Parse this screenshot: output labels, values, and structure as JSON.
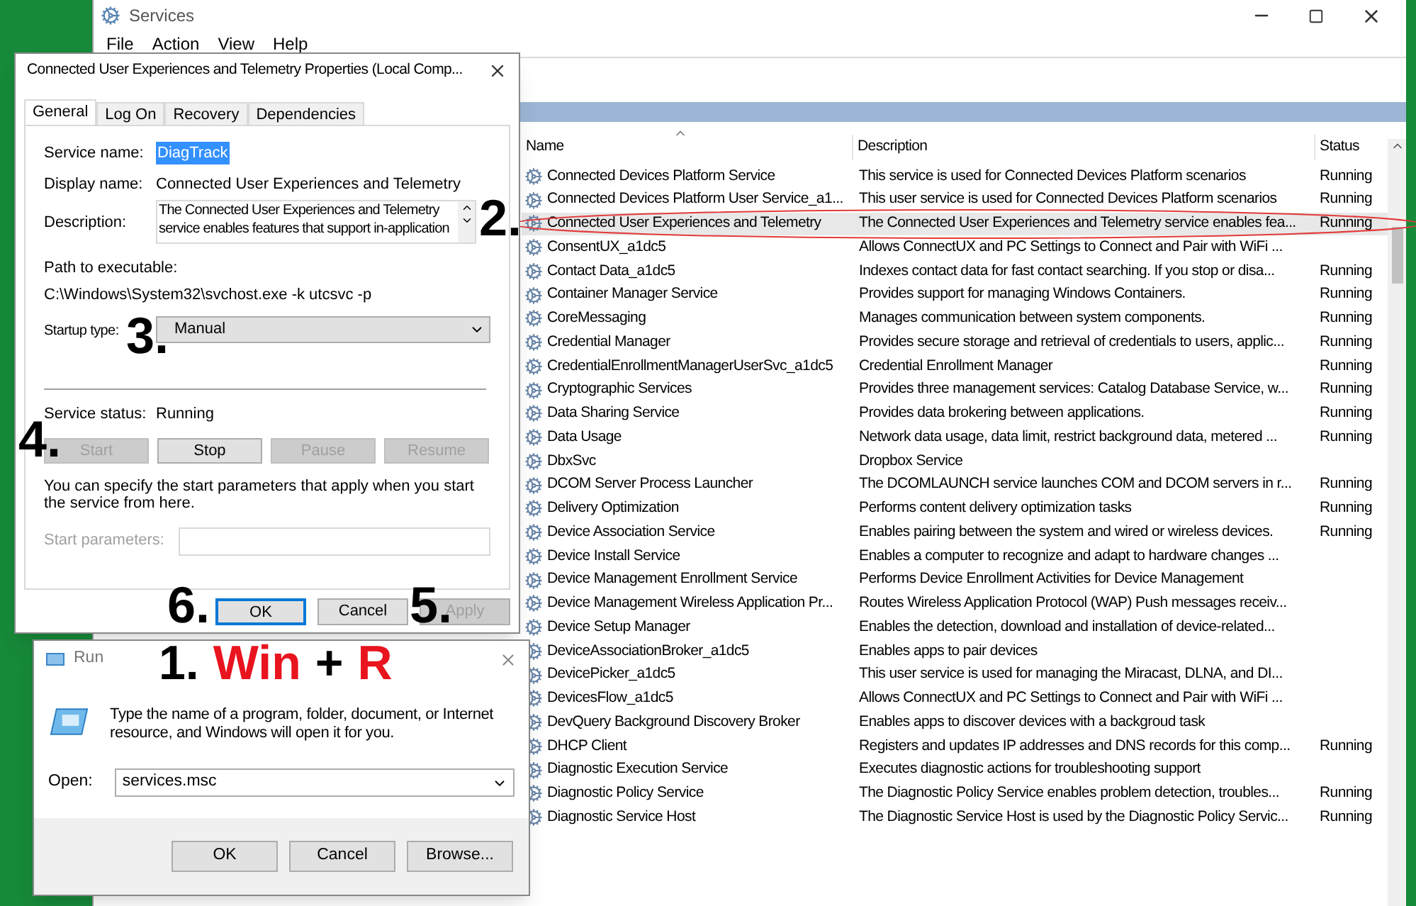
{
  "services_window": {
    "title": "Services",
    "menu": [
      "File",
      "Action",
      "View",
      "Help"
    ],
    "columns": [
      "Name",
      "Description",
      "Status"
    ],
    "rows": [
      {
        "name": "Connected Devices Platform Service",
        "description": "This service is used for Connected Devices Platform scenarios",
        "status": "Running",
        "selected": false
      },
      {
        "name": "Connected Devices Platform User Service_a1...",
        "description": "This user service is used for Connected Devices Platform scenarios",
        "status": "Running",
        "selected": false
      },
      {
        "name": "Connected User Experiences and Telemetry",
        "description": "The Connected User Experiences and Telemetry service enables fea...",
        "status": "Running",
        "selected": true
      },
      {
        "name": "ConsentUX_a1dc5",
        "description": "Allows ConnectUX and PC Settings to Connect and Pair with WiFi ...",
        "selected": false
      },
      {
        "name": "Contact Data_a1dc5",
        "description": "Indexes contact data for fast contact searching. If you stop or disa...",
        "status": "Running",
        "selected": false
      },
      {
        "name": "Container Manager Service",
        "description": "Provides support for managing Windows Containers.",
        "status": "Running",
        "selected": false
      },
      {
        "name": "CoreMessaging",
        "description": "Manages communication between system components.",
        "status": "Running",
        "selected": false
      },
      {
        "name": "Credential Manager",
        "description": "Provides secure storage and retrieval of credentials to users, applic...",
        "status": "Running",
        "selected": false
      },
      {
        "name": "CredentialEnrollmentManagerUserSvc_a1dc5",
        "description": "Credential Enrollment Manager",
        "status": "Running",
        "selected": false
      },
      {
        "name": "Cryptographic Services",
        "description": "Provides three management services: Catalog Database Service, w...",
        "status": "Running",
        "selected": false
      },
      {
        "name": "Data Sharing Service",
        "description": "Provides data brokering between applications.",
        "status": "Running",
        "selected": false
      },
      {
        "name": "Data Usage",
        "description": "Network data usage, data limit, restrict background data, metered ...",
        "status": "Running",
        "selected": false
      },
      {
        "name": "DbxSvc",
        "description": "Dropbox Service",
        "selected": false
      },
      {
        "name": "DCOM Server Process Launcher",
        "description": "The DCOMLAUNCH service launches COM and DCOM servers in r...",
        "status": "Running",
        "selected": false
      },
      {
        "name": "Delivery Optimization",
        "description": "Performs content delivery optimization tasks",
        "status": "Running",
        "selected": false
      },
      {
        "name": "Device Association Service",
        "description": "Enables pairing between the system and wired or wireless devices.",
        "status": "Running",
        "selected": false
      },
      {
        "name": "Device Install Service",
        "description": "Enables a computer to recognize and adapt to hardware changes ...",
        "selected": false
      },
      {
        "name": "Device Management Enrollment Service",
        "description": "Performs Device Enrollment Activities for Device Management",
        "selected": false
      },
      {
        "name": "Device Management Wireless Application Pr...",
        "description": "Routes Wireless Application Protocol (WAP) Push messages receiv...",
        "selected": false
      },
      {
        "name": "Device Setup Manager",
        "description": "Enables the detection, download and installation of device-related...",
        "selected": false
      },
      {
        "name": "DeviceAssociationBroker_a1dc5",
        "description": "Enables apps to pair devices",
        "selected": false
      },
      {
        "name": "DevicePicker_a1dc5",
        "description": "This user service is used for managing the Miracast, DLNA, and DI...",
        "selected": false
      },
      {
        "name": "DevicesFlow_a1dc5",
        "description": "Allows ConnectUX and PC Settings to Connect and Pair with WiFi ...",
        "selected": false
      },
      {
        "name": "DevQuery Background Discovery Broker",
        "description": "Enables apps to discover devices with a backgroud task",
        "selected": false
      },
      {
        "name": "DHCP Client",
        "description": "Registers and updates IP addresses and DNS records for this comp...",
        "status": "Running",
        "selected": false
      },
      {
        "name": "Diagnostic Execution Service",
        "description": "Executes diagnostic actions for troubleshooting support",
        "selected": false
      },
      {
        "name": "Diagnostic Policy Service",
        "description": "The Diagnostic Policy Service enables problem detection, troubles...",
        "status": "Running",
        "selected": false
      },
      {
        "name": "Diagnostic Service Host",
        "description": "The Diagnostic Service Host is used by the Diagnostic Policy Servic...",
        "status": "Running",
        "selected": false
      }
    ]
  },
  "properties_dialog": {
    "title": "Connected User Experiences and Telemetry Properties (Local Comp...",
    "tabs": [
      {
        "label": "General",
        "selected": true
      },
      {
        "label": "Log On",
        "selected": false
      },
      {
        "label": "Recovery",
        "selected": false
      },
      {
        "label": "Dependencies",
        "selected": false
      }
    ],
    "service_name_label": "Service name:",
    "service_name": "DiagTrack",
    "display_name_label": "Display name:",
    "display_name": "Connected User Experiences and Telemetry",
    "description_label": "Description:",
    "description": "The Connected User Experiences and Telemetry service enables features that support in-application",
    "path_label": "Path to executable:",
    "path": "C:\\Windows\\System32\\svchost.exe -k utcsvc -p",
    "startup_type_label": "Startup type:",
    "startup_type": "Manual",
    "status_label": "Service status:",
    "status": "Running",
    "control_buttons": [
      {
        "label": "Start",
        "disabled": true
      },
      {
        "label": "Stop",
        "disabled": false
      },
      {
        "label": "Pause",
        "disabled": true
      },
      {
        "label": "Resume",
        "disabled": true
      }
    ],
    "hint": "You can specify the start parameters that apply when you start the service from here.",
    "start_params_label": "Start parameters:",
    "start_params_disabled": true,
    "buttons": [
      {
        "label": "OK",
        "disabled": false,
        "focused": true
      },
      {
        "label": "Cancel",
        "disabled": false,
        "focused": false
      },
      {
        "label": "Apply",
        "disabled": true,
        "focused": false
      }
    ]
  },
  "run_dialog": {
    "title": "Run",
    "message": "Type the name of a program, folder, document, or Internet resource, and Windows will open it for you.",
    "open_label": "Open:",
    "open_value": "services.msc",
    "buttons": [
      "OK",
      "Cancel",
      "Browse..."
    ]
  },
  "annotations": {
    "steps": [
      "2.",
      "3.",
      "4.",
      "6.",
      "5."
    ],
    "shortcut": [
      {
        "text": "1.",
        "color": "#000000"
      },
      {
        "text": "Win",
        "color": "#e8141e"
      },
      {
        "text": "+",
        "color": "#000000"
      },
      {
        "text": "R",
        "color": "#e8141e"
      }
    ]
  }
}
